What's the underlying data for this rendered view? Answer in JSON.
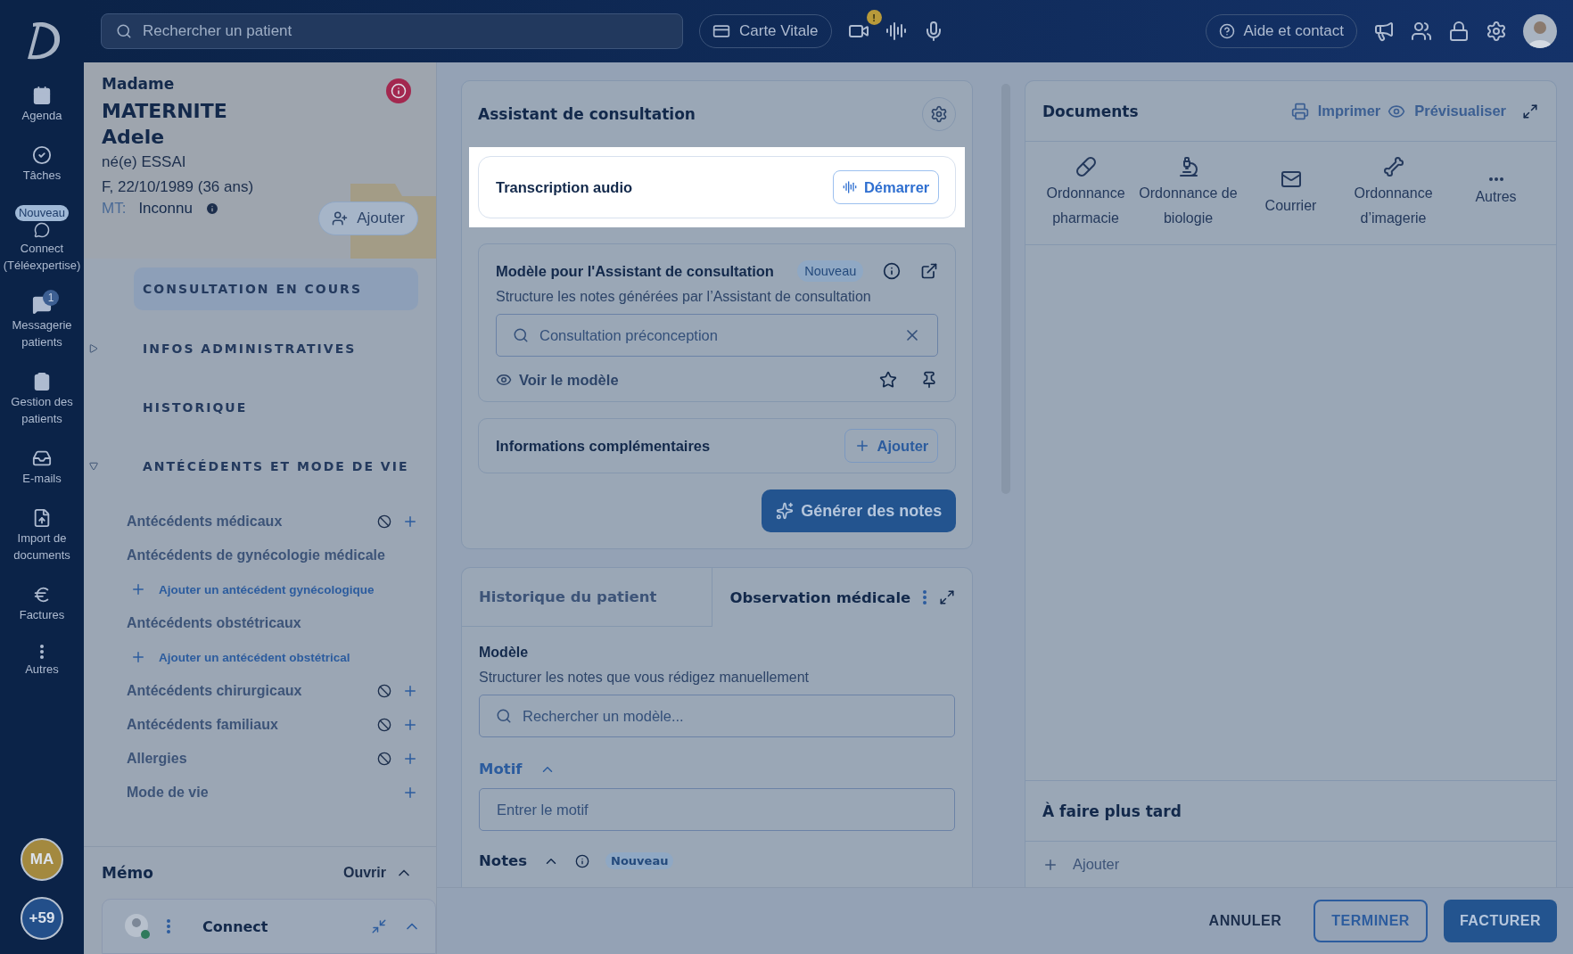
{
  "nav": {
    "items": [
      {
        "kind": "calendar",
        "label": "Agenda"
      },
      {
        "kind": "check",
        "label": "Tâches"
      },
      {
        "kind": "chat",
        "label": "Connect (Téléexpertise)",
        "badge": "Nouveau"
      },
      {
        "kind": "message",
        "label": "Messagerie patients",
        "count": "1"
      },
      {
        "kind": "clipboard",
        "label": "Gestion des patients"
      },
      {
        "kind": "inbox",
        "label": "E-mails"
      },
      {
        "kind": "upload",
        "label": "Import de documents"
      },
      {
        "kind": "euro",
        "label": "Factures"
      },
      {
        "kind": "more",
        "label": "Autres"
      }
    ],
    "user_initials": "MA",
    "more_users": "+59"
  },
  "topbar": {
    "search_placeholder": "Rechercher un patient",
    "card_button": "Carte Vitale",
    "video_alert": "!",
    "help_button": "Aide et contact"
  },
  "patient": {
    "civility": "Madame",
    "last_name": "MATERNITE",
    "first_name": "Adele",
    "birth_name": "né(e) ESSAI",
    "details": "F, 22/10/1989 (36 ans)",
    "mt_label": "MT:",
    "mt_value": "Inconnu",
    "add_button": "Ajouter"
  },
  "sections": [
    {
      "label": "CONSULTATION EN COURS",
      "selected": true,
      "kind": "plain"
    },
    {
      "label": "INFOS ADMINISTRATIVES",
      "selected": false,
      "kind": "toggle",
      "expanded": false
    },
    {
      "label": "HISTORIQUE",
      "selected": false,
      "kind": "plain"
    },
    {
      "label": "ANTÉCÉDENTS ET MODE DE VIE",
      "selected": false,
      "kind": "toggle",
      "expanded": true
    }
  ],
  "antecedents": [
    {
      "kind": "category",
      "label": "Antécédents médicaux",
      "none_button": true,
      "add_button": true
    },
    {
      "kind": "category",
      "label": "Antécédents de gynécologie médicale",
      "none_button": false,
      "add_button": false
    },
    {
      "kind": "add_link",
      "label": "Ajouter un antécédent gynécologique"
    },
    {
      "kind": "category",
      "label": "Antécédents obstétricaux",
      "none_button": false,
      "add_button": false
    },
    {
      "kind": "add_link",
      "label": "Ajouter un antécédent obstétrical"
    },
    {
      "kind": "category",
      "label": "Antécédents chirurgicaux",
      "none_button": true,
      "add_button": true
    },
    {
      "kind": "category",
      "label": "Antécédents familiaux",
      "none_button": true,
      "add_button": true
    },
    {
      "kind": "category",
      "label": "Allergies",
      "none_button": true,
      "add_button": true
    },
    {
      "kind": "category",
      "label": "Mode de vie",
      "none_button": false,
      "add_button": true
    }
  ],
  "memo": {
    "title": "Mémo",
    "open_button": "Ouvrir"
  },
  "connect": {
    "title": "Connect"
  },
  "assistant": {
    "title": "Assistant de consultation",
    "transcription": {
      "label": "Transcription audio",
      "button": "Démarrer"
    },
    "model": {
      "title": "Modèle pour l'Assistant de consultation",
      "badge": "Nouveau",
      "description": "Structure les notes générées par l’Assistant de consultation",
      "value": "Consultation préconception",
      "view_link": "Voir le modèle"
    },
    "extra": {
      "label": "Informations complémentaires",
      "button": "Ajouter"
    },
    "generate_button": "Générer des notes"
  },
  "observation": {
    "tabs": [
      {
        "label": "Historique du patient",
        "selected": false
      },
      {
        "label": "Observation médicale",
        "selected": true
      }
    ],
    "model_title": "Modèle",
    "model_description": "Structurer les notes que vous rédigez manuellement",
    "model_placeholder": "Rechercher un modèle...",
    "motif_label": "Motif",
    "motif_placeholder": "Entrer le motif",
    "notes_label": "Notes",
    "notes_badge": "Nouveau"
  },
  "documents": {
    "title": "Documents",
    "print_button": "Imprimer",
    "preview_button": "Prévisualiser",
    "types": [
      {
        "kind": "pills",
        "label": "Ordonnance pharmacie"
      },
      {
        "kind": "microscope",
        "label": "Ordonnance de biologie"
      },
      {
        "kind": "mail",
        "label": "Courrier"
      },
      {
        "kind": "bone",
        "label": "Ordonnance d’imagerie"
      },
      {
        "kind": "more",
        "label": "Autres"
      }
    ],
    "later_title": "À faire plus tard",
    "later_add": "Ajouter"
  },
  "footer": {
    "buttons": [
      {
        "label": "ANNULER",
        "kind": "text"
      },
      {
        "label": "TERMINER",
        "kind": "outline"
      },
      {
        "label": "FACTURER",
        "kind": "filled"
      }
    ]
  }
}
